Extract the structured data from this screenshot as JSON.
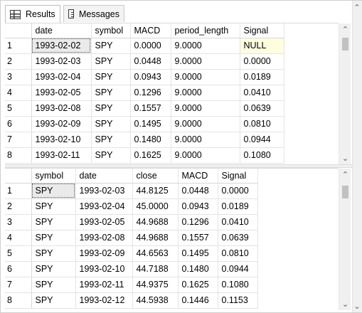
{
  "tabs": [
    {
      "label": "Results",
      "icon": "grid-icon",
      "active": true
    },
    {
      "label": "Messages",
      "icon": "messages-icon",
      "active": false
    }
  ],
  "grid1": {
    "columns": [
      "",
      "date",
      "symbol",
      "MACD",
      "period_length",
      "Signal"
    ],
    "rows": [
      [
        "1",
        "1993-02-02",
        "SPY",
        "0.0000",
        "9.0000",
        "NULL"
      ],
      [
        "2",
        "1993-02-03",
        "SPY",
        "0.0448",
        "9.0000",
        "0.0000"
      ],
      [
        "3",
        "1993-02-04",
        "SPY",
        "0.0943",
        "9.0000",
        "0.0189"
      ],
      [
        "4",
        "1993-02-05",
        "SPY",
        "0.1296",
        "9.0000",
        "0.0410"
      ],
      [
        "5",
        "1993-02-08",
        "SPY",
        "0.1557",
        "9.0000",
        "0.0639"
      ],
      [
        "6",
        "1993-02-09",
        "SPY",
        "0.1495",
        "9.0000",
        "0.0810"
      ],
      [
        "7",
        "1993-02-10",
        "SPY",
        "0.1480",
        "9.0000",
        "0.0944"
      ],
      [
        "8",
        "1993-02-11",
        "SPY",
        "0.1625",
        "9.0000",
        "0.1080"
      ]
    ]
  },
  "grid2": {
    "columns": [
      "",
      "symbol",
      "date",
      "close",
      "MACD",
      "Signal"
    ],
    "rows": [
      [
        "1",
        "SPY",
        "1993-02-03",
        "44.8125",
        "0.0448",
        "0.0000"
      ],
      [
        "2",
        "SPY",
        "1993-02-04",
        "45.0000",
        "0.0943",
        "0.0189"
      ],
      [
        "3",
        "SPY",
        "1993-02-05",
        "44.9688",
        "0.1296",
        "0.0410"
      ],
      [
        "4",
        "SPY",
        "1993-02-08",
        "44.9688",
        "0.1557",
        "0.0639"
      ],
      [
        "5",
        "SPY",
        "1993-02-09",
        "44.6563",
        "0.1495",
        "0.0810"
      ],
      [
        "6",
        "SPY",
        "1993-02-10",
        "44.7188",
        "0.1480",
        "0.0944"
      ],
      [
        "7",
        "SPY",
        "1993-02-11",
        "44.9375",
        "0.1625",
        "0.1080"
      ],
      [
        "8",
        "SPY",
        "1993-02-12",
        "44.5938",
        "0.1446",
        "0.1153"
      ]
    ]
  },
  "scroll": {
    "up_glyph": "⌃",
    "down_glyph": "⌄"
  }
}
